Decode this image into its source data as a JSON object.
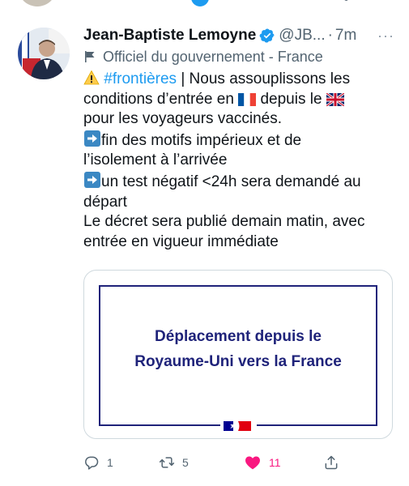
{
  "colors": {
    "accent": "#1d9bf0",
    "text": "#0f1419",
    "muted": "#536471",
    "like": "#f91880",
    "card_navy": "#1f237a",
    "border": "#cfd9de"
  },
  "tweet": {
    "author": {
      "name": "Jean-Baptiste Lemoyne",
      "handle": "@JB...",
      "verified_icon": "verified-badge-icon",
      "avatar_icon": "profile-avatar"
    },
    "separator": "·",
    "time": "7m",
    "more_icon": "more-options-icon",
    "more_glyph": "···",
    "label": {
      "icon": "flag-icon",
      "text": "Officiel du gouvernement - France"
    },
    "text": {
      "line1_hashtag": "#frontières",
      "line1_rest": " | Nous assouplissons les",
      "line2_a": "conditions d’entrée en ",
      "line2_b": " depuis le ",
      "line3": "pour les voyageurs vaccinés.",
      "line4": "fin des motifs impérieux et de",
      "line5": "l’isolement à l’arrivée",
      "line6": "un test négatif <24h sera demandé au",
      "line7": "départ",
      "line8": "Le décret sera publié demain matin, avec",
      "line9": "entrée en vigueur immédiate"
    },
    "emoji_icons": [
      "warning-icon",
      "france-flag-icon",
      "uk-flag-icon",
      "right-arrow-icon"
    ],
    "card": {
      "title_line1": "Déplacement depuis le",
      "title_line2": "Royaume-Uni vers la France",
      "logo_icon": "french-republic-logo"
    },
    "actions": {
      "reply_count": "1",
      "retweet_count": "5",
      "like_count": "11",
      "liked": true
    }
  }
}
